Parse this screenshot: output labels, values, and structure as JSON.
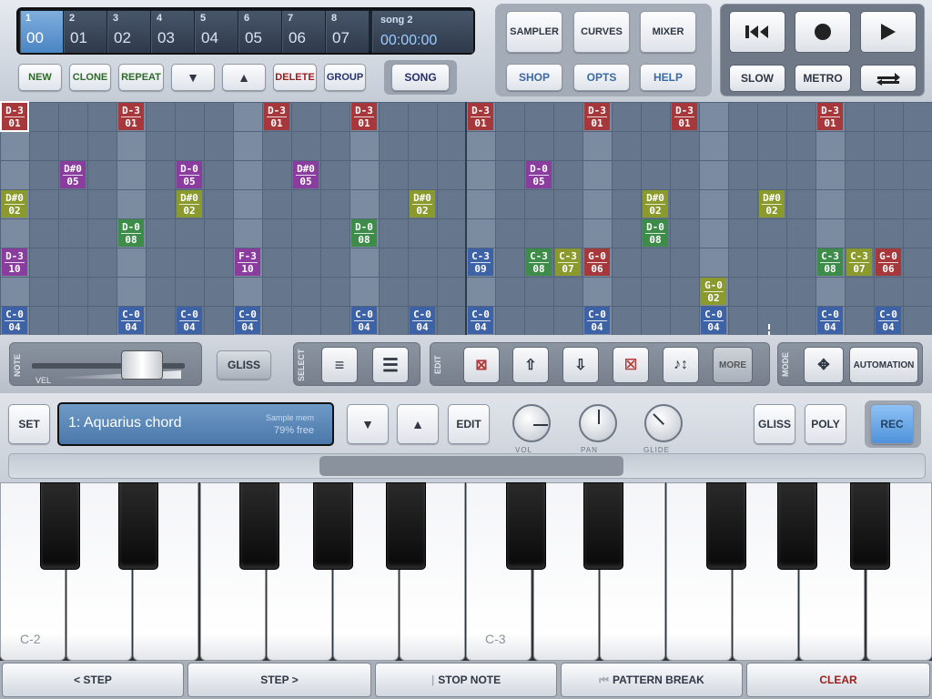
{
  "patterns": [
    {
      "num": "1",
      "val": "00",
      "selected": true
    },
    {
      "num": "2",
      "val": "01"
    },
    {
      "num": "3",
      "val": "02"
    },
    {
      "num": "4",
      "val": "03"
    },
    {
      "num": "5",
      "val": "04"
    },
    {
      "num": "6",
      "val": "05"
    },
    {
      "num": "7",
      "val": "06"
    },
    {
      "num": "8",
      "val": "07"
    }
  ],
  "song": {
    "name": "song 2",
    "time": "00:00:00"
  },
  "pattern_buttons": {
    "new": "NEW",
    "clone": "CLONE",
    "repeat": "REPEAT",
    "delete": "DELETE",
    "group": "GROUP",
    "song": "SONG"
  },
  "top_buttons": {
    "sampler": "SAMPLER",
    "curves": "CURVES",
    "mixer": "MIXER",
    "shop": "SHOP",
    "opts": "OPTS",
    "help": "HELP"
  },
  "transport": {
    "slow": "SLOW",
    "metro": "METRO"
  },
  "notes": [
    {
      "col": 0,
      "row": 0,
      "top": "D-3",
      "bottom": "01",
      "color": "#a6383c"
    },
    {
      "col": 4,
      "row": 0,
      "top": "D-3",
      "bottom": "01",
      "color": "#a6383c"
    },
    {
      "col": 9,
      "row": 0,
      "top": "D-3",
      "bottom": "01",
      "color": "#a6383c"
    },
    {
      "col": 12,
      "row": 0,
      "top": "D-3",
      "bottom": "01",
      "color": "#a6383c"
    },
    {
      "col": 16,
      "row": 0,
      "top": "D-3",
      "bottom": "01",
      "color": "#a6383c"
    },
    {
      "col": 20,
      "row": 0,
      "top": "D-3",
      "bottom": "01",
      "color": "#a6383c"
    },
    {
      "col": 23,
      "row": 0,
      "top": "D-3",
      "bottom": "01",
      "color": "#a6383c"
    },
    {
      "col": 28,
      "row": 0,
      "top": "D-3",
      "bottom": "01",
      "color": "#a6383c"
    },
    {
      "col": 2,
      "row": 2,
      "top": "D#0",
      "bottom": "05",
      "color": "#8a3d9e"
    },
    {
      "col": 6,
      "row": 2,
      "top": "D-0",
      "bottom": "05",
      "color": "#8a3d9e"
    },
    {
      "col": 10,
      "row": 2,
      "top": "D#0",
      "bottom": "05",
      "color": "#8a3d9e"
    },
    {
      "col": 18,
      "row": 2,
      "top": "D-0",
      "bottom": "05",
      "color": "#8a3d9e"
    },
    {
      "col": 0,
      "row": 3,
      "top": "D#0",
      "bottom": "02",
      "color": "#8b9a2c"
    },
    {
      "col": 6,
      "row": 3,
      "top": "D#0",
      "bottom": "02",
      "color": "#8b9a2c"
    },
    {
      "col": 14,
      "row": 3,
      "top": "D#0",
      "bottom": "02",
      "color": "#8b9a2c"
    },
    {
      "col": 22,
      "row": 3,
      "top": "D#0",
      "bottom": "02",
      "color": "#8b9a2c"
    },
    {
      "col": 26,
      "row": 3,
      "top": "D#0",
      "bottom": "02",
      "color": "#8b9a2c"
    },
    {
      "col": 4,
      "row": 4,
      "top": "D-0",
      "bottom": "08",
      "color": "#3d8c49"
    },
    {
      "col": 12,
      "row": 4,
      "top": "D-0",
      "bottom": "08",
      "color": "#3d8c49"
    },
    {
      "col": 22,
      "row": 4,
      "top": "D-0",
      "bottom": "08",
      "color": "#3d8c49"
    },
    {
      "col": 0,
      "row": 5,
      "top": "D-3",
      "bottom": "10",
      "color": "#8a3d9e"
    },
    {
      "col": 8,
      "row": 5,
      "top": "F-3",
      "bottom": "10",
      "color": "#8a3d9e"
    },
    {
      "col": 16,
      "row": 5,
      "top": "C-3",
      "bottom": "09",
      "color": "#3d62a6"
    },
    {
      "col": 18,
      "row": 5,
      "top": "C-3",
      "bottom": "08",
      "color": "#3d8c49"
    },
    {
      "col": 19,
      "row": 5,
      "top": "C-3",
      "bottom": "07",
      "color": "#8b9a2c"
    },
    {
      "col": 20,
      "row": 5,
      "top": "G-0",
      "bottom": "06",
      "color": "#a6383c"
    },
    {
      "col": 28,
      "row": 5,
      "top": "C-3",
      "bottom": "08",
      "color": "#3d8c49"
    },
    {
      "col": 29,
      "row": 5,
      "top": "C-3",
      "bottom": "07",
      "color": "#8b9a2c"
    },
    {
      "col": 30,
      "row": 5,
      "top": "G-0",
      "bottom": "06",
      "color": "#a6383c"
    },
    {
      "col": 24,
      "row": 6,
      "top": "G-0",
      "bottom": "02",
      "color": "#8b9a2c"
    },
    {
      "col": 0,
      "row": 7,
      "top": "C-0",
      "bottom": "04",
      "color": "#3d62a6"
    },
    {
      "col": 4,
      "row": 7,
      "top": "C-0",
      "bottom": "04",
      "color": "#3d62a6"
    },
    {
      "col": 6,
      "row": 7,
      "top": "C-0",
      "bottom": "04",
      "color": "#3d62a6"
    },
    {
      "col": 8,
      "row": 7,
      "top": "C-0",
      "bottom": "04",
      "color": "#3d62a6"
    },
    {
      "col": 12,
      "row": 7,
      "top": "C-0",
      "bottom": "04",
      "color": "#3d62a6"
    },
    {
      "col": 14,
      "row": 7,
      "top": "C-0",
      "bottom": "04",
      "color": "#3d62a6"
    },
    {
      "col": 16,
      "row": 7,
      "top": "C-0",
      "bottom": "04",
      "color": "#3d62a6"
    },
    {
      "col": 20,
      "row": 7,
      "top": "C-0",
      "bottom": "04",
      "color": "#3d62a6"
    },
    {
      "col": 24,
      "row": 7,
      "top": "C-0",
      "bottom": "04",
      "color": "#3d62a6"
    },
    {
      "col": 28,
      "row": 7,
      "top": "C-0",
      "bottom": "04",
      "color": "#3d62a6"
    },
    {
      "col": 30,
      "row": 7,
      "top": "C-0",
      "bottom": "04",
      "color": "#3d62a6"
    }
  ],
  "toolbar": {
    "note_label": "NOTE",
    "vel_label": "VEL",
    "gliss": "GLISS",
    "select_label": "SELECT",
    "edit_label": "EDIT",
    "more": "MORE",
    "mode_label": "MODE",
    "automation": "AUTOMATION"
  },
  "instrument": {
    "set": "SET",
    "name": "1: Aquarius chord",
    "mem_label": "Sample mem",
    "mem_free": "79% free",
    "edit": "EDIT",
    "vol": "VOL",
    "pan": "PAN",
    "glide": "GLIDE",
    "gliss": "GLISS",
    "poly": "POLY",
    "rec": "REC"
  },
  "keyboard": {
    "label_c2": "C-2",
    "label_c3": "C-3"
  },
  "bottom": {
    "step_back": "< STEP",
    "step_fwd": "STEP >",
    "stop_note": "STOP NOTE",
    "pattern_break": "PATTERN BREAK",
    "clear": "CLEAR"
  },
  "colors": {
    "rec_active": "#5b9be0",
    "clear_text": "#9c1c1c"
  }
}
